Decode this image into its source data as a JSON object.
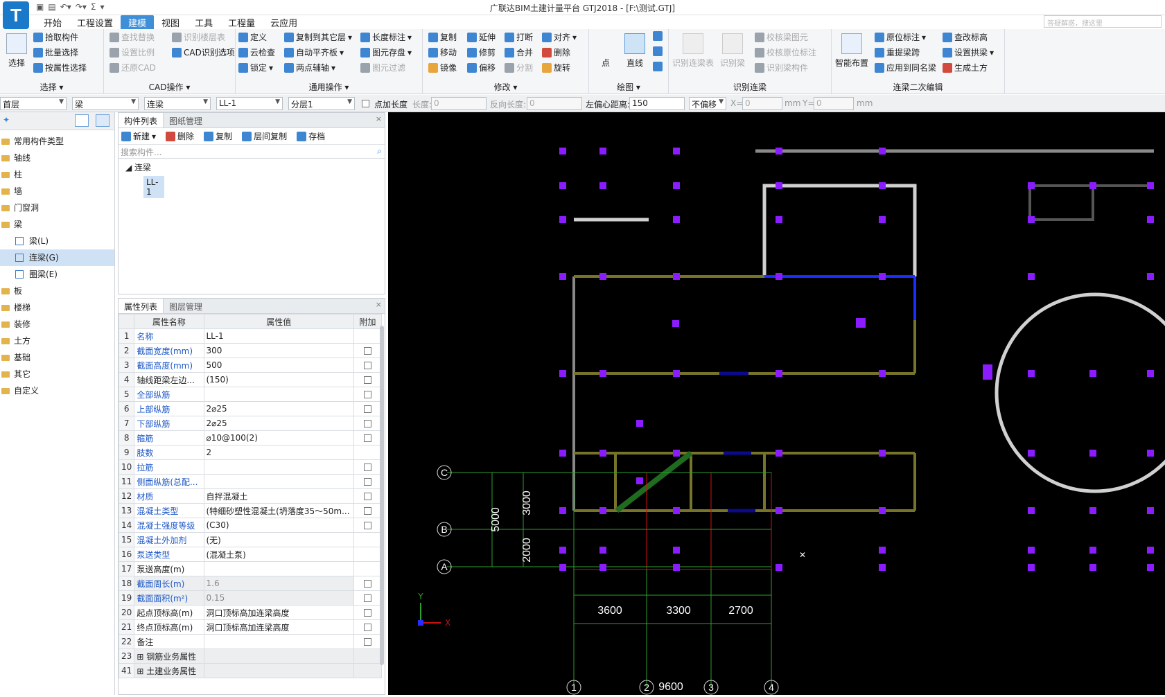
{
  "app": {
    "logo": "T",
    "title": "广联达BIM土建计量平台 GTJ2018 - [F:\\测试.GTJ]",
    "search_placeholder": "答疑解惑，搜这里"
  },
  "menu_tabs": [
    "开始",
    "工程设置",
    "建模",
    "视图",
    "工具",
    "工程量",
    "云应用"
  ],
  "active_tab": "建模",
  "ribbon": {
    "select_group": {
      "big": "选择",
      "items": [
        "拾取构件",
        "批量选择",
        "按属性选择"
      ],
      "label": "选择"
    },
    "cad_group": {
      "items": [
        "查找替换",
        "识别楼层表",
        "设置比例",
        "CAD识别选项",
        "还原CAD"
      ],
      "label": "CAD操作"
    },
    "common_group": {
      "items": [
        "定义",
        "复制到其它层",
        "长度标注",
        "云检查",
        "自动平齐板",
        "图元存盘",
        "锁定",
        "两点辅轴",
        "图元过滤"
      ],
      "label": "通用操作"
    },
    "modify_group": {
      "items": [
        "复制",
        "延伸",
        "打断",
        "对齐",
        "移动",
        "修剪",
        "合并",
        "删除",
        "镜像",
        "偏移",
        "分割",
        "旋转"
      ],
      "label": "修改"
    },
    "draw_group": {
      "items": [
        "点",
        "直线"
      ],
      "label": "绘图"
    },
    "identify_group": {
      "items": [
        "识别连梁表",
        "识别梁",
        "校核梁图元",
        "校核原位标注",
        "识别梁构件"
      ],
      "label": "识别连梁"
    },
    "edit2_group": {
      "big": "智能布置",
      "items": [
        "原位标注",
        "重提梁跨",
        "应用到同名梁",
        "查改标高",
        "设置拱梁",
        "生成土方"
      ],
      "label": "连梁二次编辑"
    }
  },
  "toolbar2": {
    "floor": "首层",
    "type": "梁",
    "subtype": "连梁",
    "component": "LL-1",
    "layer": "分层1",
    "point_length_label": "点加长度",
    "length_label": "长度:",
    "length_value": "0",
    "reverse_label": "反向长度:",
    "reverse_value": "0",
    "offset_label": "左偏心距离:",
    "offset_value": "150",
    "no_offset": "不偏移",
    "x_label": "X=",
    "x_value": "0",
    "y_label": "Y=",
    "y_value": "0",
    "unit": "mm"
  },
  "tree": {
    "items": [
      {
        "label": "常用构件类型",
        "type": "folder"
      },
      {
        "label": "轴线",
        "type": "folder"
      },
      {
        "label": "柱",
        "type": "folder"
      },
      {
        "label": "墙",
        "type": "folder"
      },
      {
        "label": "门窗洞",
        "type": "folder"
      },
      {
        "label": "梁",
        "type": "folder"
      },
      {
        "label": "梁(L)",
        "type": "sub"
      },
      {
        "label": "连梁(G)",
        "type": "sub",
        "selected": true
      },
      {
        "label": "圈梁(E)",
        "type": "sub"
      },
      {
        "label": "板",
        "type": "folder"
      },
      {
        "label": "楼梯",
        "type": "folder"
      },
      {
        "label": "装修",
        "type": "folder"
      },
      {
        "label": "土方",
        "type": "folder"
      },
      {
        "label": "基础",
        "type": "folder"
      },
      {
        "label": "其它",
        "type": "folder"
      },
      {
        "label": "自定义",
        "type": "folder"
      }
    ]
  },
  "component_panel": {
    "tabs": [
      "构件列表",
      "图纸管理"
    ],
    "tools": [
      "新建",
      "删除",
      "复制",
      "层间复制",
      "存档"
    ],
    "search_placeholder": "搜索构件...",
    "group": "连梁",
    "item": "LL-1"
  },
  "property_panel": {
    "tabs": [
      "属性列表",
      "图层管理"
    ],
    "headers": [
      "属性名称",
      "属性值",
      "附加"
    ],
    "rows": [
      {
        "n": "1",
        "name": "名称",
        "value": "LL-1",
        "blue": true,
        "chk": false
      },
      {
        "n": "2",
        "name": "截面宽度(mm)",
        "value": "300",
        "blue": true,
        "chk": true
      },
      {
        "n": "3",
        "name": "截面高度(mm)",
        "value": "500",
        "blue": true,
        "chk": true
      },
      {
        "n": "4",
        "name": "轴线距梁左边...",
        "value": "(150)",
        "blue": false,
        "chk": true
      },
      {
        "n": "5",
        "name": "全部纵筋",
        "value": "",
        "blue": true,
        "chk": true
      },
      {
        "n": "6",
        "name": "上部纵筋",
        "value": "2⌀25",
        "blue": true,
        "chk": true
      },
      {
        "n": "7",
        "name": "下部纵筋",
        "value": "2⌀25",
        "blue": true,
        "chk": true
      },
      {
        "n": "8",
        "name": "箍筋",
        "value": "⌀10@100(2)",
        "blue": true,
        "chk": true
      },
      {
        "n": "9",
        "name": "肢数",
        "value": "2",
        "blue": true,
        "chk": false
      },
      {
        "n": "10",
        "name": "拉筋",
        "value": "",
        "blue": true,
        "chk": true
      },
      {
        "n": "11",
        "name": "侧面纵筋(总配...",
        "value": "",
        "blue": true,
        "chk": true
      },
      {
        "n": "12",
        "name": "材质",
        "value": "自拌混凝土",
        "blue": true,
        "chk": true
      },
      {
        "n": "13",
        "name": "混凝土类型",
        "value": "(特细砂塑性混凝土(坍落度35～50m...",
        "blue": true,
        "chk": true
      },
      {
        "n": "14",
        "name": "混凝土强度等级",
        "value": "(C30)",
        "blue": true,
        "chk": true
      },
      {
        "n": "15",
        "name": "混凝土外加剂",
        "value": "(无)",
        "blue": true,
        "chk": false
      },
      {
        "n": "16",
        "name": "泵送类型",
        "value": "(混凝土泵)",
        "blue": true,
        "chk": false
      },
      {
        "n": "17",
        "name": "泵送高度(m)",
        "value": "",
        "blue": false,
        "chk": false
      },
      {
        "n": "18",
        "name": "截面周长(m)",
        "value": "1.6",
        "blue": true,
        "chk": true,
        "gray": true
      },
      {
        "n": "19",
        "name": "截面面积(m²)",
        "value": "0.15",
        "blue": true,
        "chk": true,
        "gray": true
      },
      {
        "n": "20",
        "name": "起点顶标高(m)",
        "value": "洞口顶标高加连梁高度",
        "blue": false,
        "chk": true
      },
      {
        "n": "21",
        "name": "终点顶标高(m)",
        "value": "洞口顶标高加连梁高度",
        "blue": false,
        "chk": true
      },
      {
        "n": "22",
        "name": "备注",
        "value": "",
        "blue": false,
        "chk": true
      },
      {
        "n": "23",
        "name": "钢筋业务属性",
        "value": "",
        "blue": false,
        "chk": false,
        "group": true
      },
      {
        "n": "41",
        "name": "土建业务属性",
        "value": "",
        "blue": false,
        "chk": false,
        "group": true
      }
    ]
  },
  "canvas": {
    "axis_rows": [
      "C",
      "B",
      "A"
    ],
    "axis_cols": [
      "1",
      "2",
      "3",
      "4"
    ],
    "dims_h": [
      "3600",
      "3300",
      "2700"
    ],
    "dim_total_h": "9600",
    "dims_v": [
      "3000",
      "2000"
    ],
    "dim_total_v": "5000",
    "ucs_y": "Y",
    "ucs_x": "X"
  }
}
